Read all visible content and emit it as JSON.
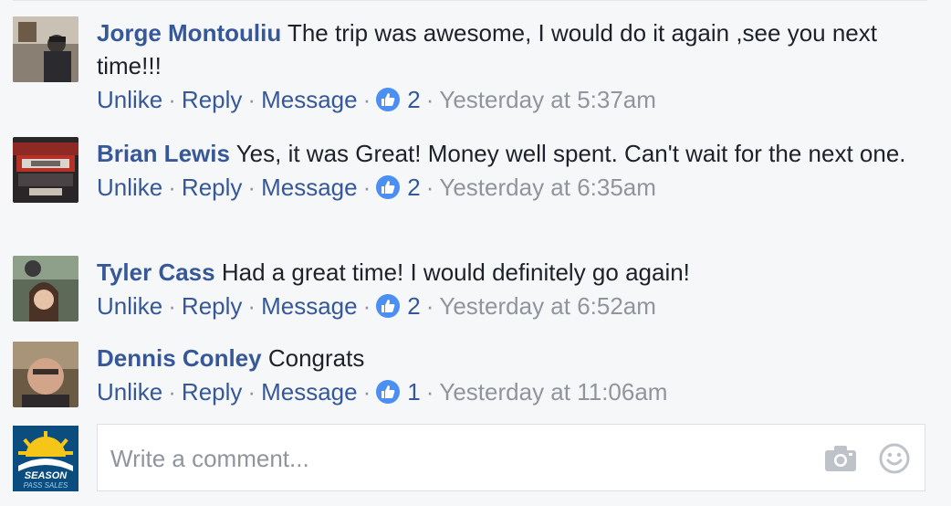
{
  "comments": [
    {
      "author": "Jorge Montouliu",
      "text": "The trip was awesome, I would do it again ,see you next time!!!",
      "actions": {
        "unlike": "Unlike",
        "reply": "Reply",
        "message": "Message",
        "likes": "2",
        "time": "Yesterday at 5:37am"
      }
    },
    {
      "author": "Brian Lewis",
      "text": "Yes, it was Great! Money well spent. Can't wait for the next one.",
      "actions": {
        "unlike": "Unlike",
        "reply": "Reply",
        "message": "Message",
        "likes": "2",
        "time": "Yesterday at 6:35am"
      }
    },
    {
      "author": "Tyler Cass",
      "text": "Had a great time! I would definitely go again!",
      "actions": {
        "unlike": "Unlike",
        "reply": "Reply",
        "message": "Message",
        "likes": "2",
        "time": "Yesterday at 6:52am"
      }
    },
    {
      "author": "Dennis Conley",
      "text": "Congrats",
      "actions": {
        "unlike": "Unlike",
        "reply": "Reply",
        "message": "Message",
        "likes": "1",
        "time": "Yesterday at 11:06am"
      }
    }
  ],
  "separator": "·",
  "composer": {
    "placeholder": "Write a comment...",
    "page_logo_text": "SEASON PASS SALES",
    "camera_icon": "camera-icon",
    "emoji_icon": "emoji-icon"
  },
  "colors": {
    "link": "#365899",
    "meta": "#90949c",
    "like_badge": "#4a8ff1",
    "background": "#f6f7f9"
  }
}
